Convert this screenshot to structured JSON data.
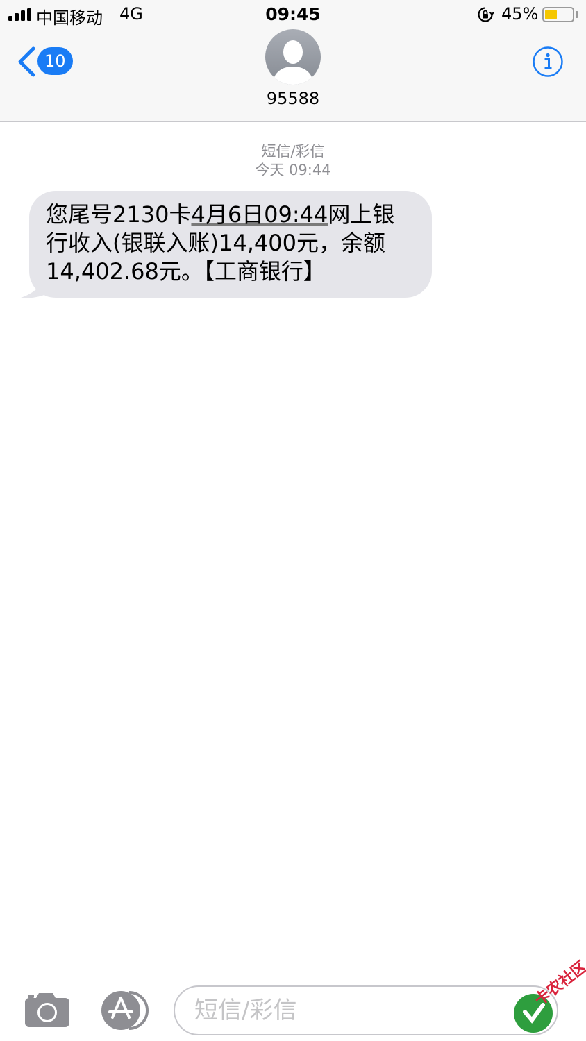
{
  "status_bar": {
    "carrier": "中国移动",
    "network": "4G",
    "time": "09:45",
    "battery_percent_label": "45%",
    "battery_level": 0.45,
    "signal_bars": 4,
    "orientation_lock_icon": "orientation-lock-icon"
  },
  "nav": {
    "back_badge": "10",
    "back_icon": "chevron-left-icon",
    "contact_name": "95588",
    "avatar_icon": "person-silhouette-icon",
    "info_icon": "info-icon"
  },
  "conversation": {
    "message_type": "短信/彩信",
    "timestamp": "今天 09:44",
    "message": {
      "part1": "您尾号2130卡",
      "date_link": "4月6日09:44",
      "part2": "网上银",
      "line2": "行收入(银联入账)14,400元，余额",
      "line3": "14,402.68元。【工商银行】"
    }
  },
  "input_bar": {
    "camera_icon": "camera-icon",
    "apps_icon": "app-store-icon",
    "placeholder": "短信/彩信"
  },
  "watermark": {
    "text": "卡农社区"
  },
  "colors": {
    "accent": "#1a7cf5",
    "bubble": "#e5e5ea",
    "header_bg": "#f7f7f7",
    "secondary_text": "#8e8e93",
    "battery": "#f5c700"
  }
}
